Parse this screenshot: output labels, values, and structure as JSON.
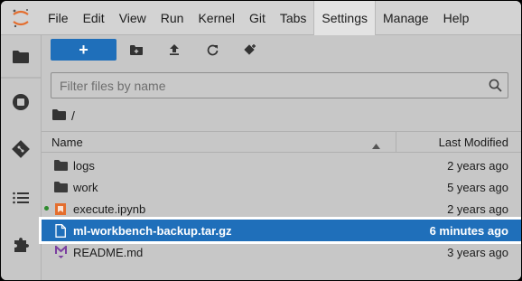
{
  "menubar": {
    "items": [
      "File",
      "Edit",
      "View",
      "Run",
      "Kernel",
      "Git",
      "Tabs",
      "Settings",
      "Manage",
      "Help"
    ],
    "active": "Settings"
  },
  "sidebar": {
    "icons": [
      "folder-icon",
      "stop-circle-icon",
      "git-icon",
      "list-icon",
      "puzzle-icon"
    ]
  },
  "toolbar": {
    "new_label": "+"
  },
  "filter": {
    "placeholder": "Filter files by name",
    "value": ""
  },
  "breadcrumb": {
    "path": "/"
  },
  "table": {
    "col_name": "Name",
    "col_modified": "Last Modified",
    "rows": [
      {
        "name": "logs",
        "modified": "2 years ago",
        "icon": "folder-icon",
        "selected": false,
        "running": false
      },
      {
        "name": "work",
        "modified": "5 years ago",
        "icon": "folder-icon",
        "selected": false,
        "running": false
      },
      {
        "name": "execute.ipynb",
        "modified": "2 years ago",
        "icon": "notebook-icon",
        "selected": false,
        "running": true
      },
      {
        "name": "ml-workbench-backup.tar.gz",
        "modified": "6 minutes ago",
        "icon": "file-icon",
        "selected": true,
        "running": false
      },
      {
        "name": "README.md",
        "modified": "3 years ago",
        "icon": "markdown-icon",
        "selected": false,
        "running": false
      }
    ]
  },
  "colors": {
    "accent": "#1f6fba",
    "menubar_bg": "#d3d3d3",
    "panel_bg": "#c7c7c7",
    "running_dot": "#2e8b2e",
    "notebook_icon": "#e46e2e",
    "markdown_icon": "#7b3fa0"
  }
}
